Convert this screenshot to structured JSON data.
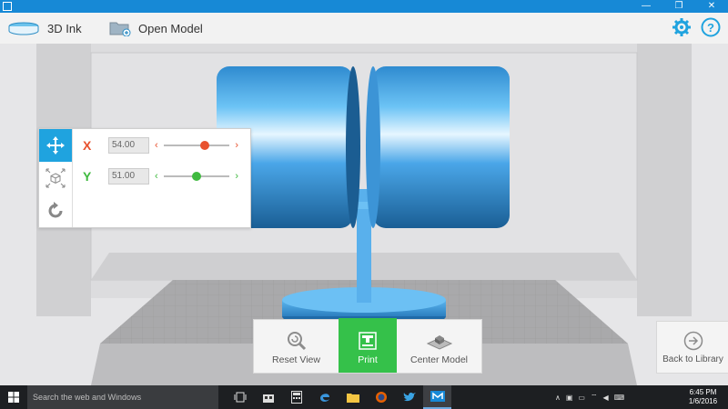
{
  "window": {
    "controls": [
      "—",
      "❐",
      "✕"
    ]
  },
  "appbar": {
    "brand_label": "3D Ink",
    "open_model_label": "Open Model"
  },
  "position_panel": {
    "x": {
      "axis": "X",
      "value": "54.00",
      "level": 0.62,
      "color": "#e8522f"
    },
    "y": {
      "axis": "Y",
      "value": "51.00",
      "level": 0.5,
      "color": "#3fba3f"
    }
  },
  "actions": {
    "reset_view_label": "Reset View",
    "print_label": "Print",
    "center_model_label": "Center Model"
  },
  "library": {
    "back_label": "Back to Library"
  },
  "taskbar": {
    "search_placeholder": "Search the web and Windows",
    "time": "6:45 PM",
    "date": "1/6/2016"
  },
  "colors": {
    "accent": "#1fa3df",
    "print_green": "#35c14a",
    "model_blue": "#4aa6e8"
  }
}
